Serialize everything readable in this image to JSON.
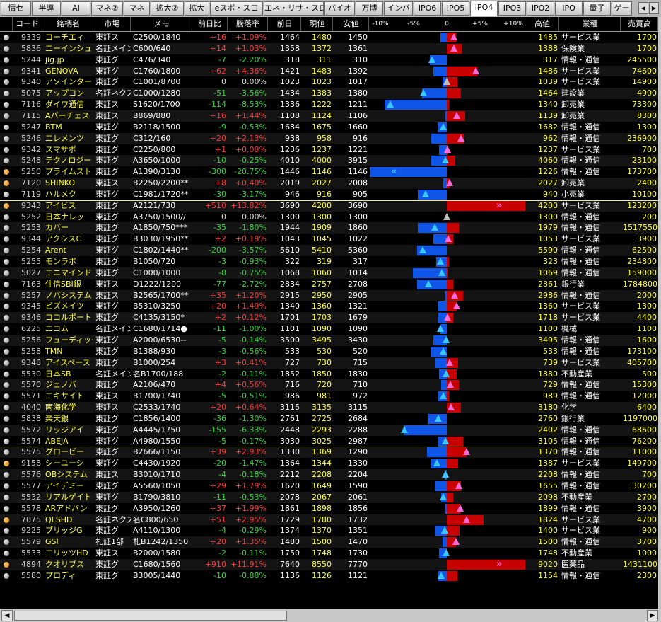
{
  "tabs": [
    "情セ",
    "半導",
    "AI",
    "マネ②",
    "マネ",
    "拡大②",
    "拡大",
    "eスポ・スロ",
    "エネ・リサ・スロ",
    "バイオ",
    "万博",
    "インバ",
    "IPO6",
    "IPO5",
    "IPO4",
    "IPO3",
    "IPO2",
    "IPO",
    "量子",
    "ゲー"
  ],
  "active_tab": "IPO4",
  "tab_nav": [
    "◀",
    "▶"
  ],
  "columns": {
    "code": "コード",
    "name": "銘柄名",
    "market": "市場",
    "memo": "メモ",
    "change": "前日比",
    "pct": "騰落率",
    "prev": "前日",
    "price": "現値",
    "low": "安値",
    "scale": [
      "-10%",
      "-5%",
      "0",
      "+5%",
      "+10%"
    ],
    "high": "高値",
    "sector": "業種",
    "value": "売買高"
  },
  "colors": {
    "up": "#ff3b3b",
    "down": "#38d838",
    "bar_up": "#c80000",
    "bar_down": "#0f55e8",
    "text": "#ffffff",
    "name": "#ffff40"
  },
  "rows": [
    {
      "mark": "grey",
      "code": "9339",
      "name": "コーチエィ",
      "market": "東証ス",
      "memo": "C2500/1840",
      "change": "+16",
      "pct": "+1.09%",
      "prev": "1464",
      "price": "1480",
      "low": "1450",
      "high": "1485",
      "sector": "サービス業",
      "value": "1700"
    },
    {
      "mark": "grey",
      "code": "5836",
      "name": "エーインシュ",
      "market": "名証メイン",
      "memo": "C600/640",
      "change": "+14",
      "pct": "+1.03%",
      "prev": "1358",
      "price": "1372",
      "low": "1361",
      "high": "1388",
      "sector": "保険業",
      "value": "1700"
    },
    {
      "mark": "grey",
      "code": "5244",
      "name": "jig.jp",
      "market": "東証グ",
      "memo": "C476/340",
      "change": "-7",
      "pct": "-2.20%",
      "prev": "318",
      "price": "311",
      "low": "310",
      "high": "317",
      "sector": "情報・通信",
      "value": "245500"
    },
    {
      "mark": "grey",
      "code": "9341",
      "name": "GENOVA",
      "market": "東証グ",
      "memo": "C1760/1800",
      "change": "+62",
      "pct": "+4.36%",
      "prev": "1421",
      "price": "1483",
      "low": "1392",
      "high": "1486",
      "sector": "サービス業",
      "value": "74600"
    },
    {
      "mark": "grey",
      "code": "9340",
      "name": "アソインター",
      "market": "東証グ",
      "memo": "C1001/8700",
      "change": "0",
      "pct": "0.00%",
      "prev": "1023",
      "price": "1023",
      "low": "1017",
      "high": "1039",
      "sector": "サービス業",
      "value": "14900"
    },
    {
      "mark": "grey",
      "code": "5075",
      "name": "アップコン",
      "market": "名証ネクス",
      "memo": "C1000/1280",
      "change": "-51",
      "pct": "-3.56%",
      "prev": "1434",
      "price": "1383",
      "low": "1380",
      "high": "1464",
      "sector": "建設業",
      "value": "4900"
    },
    {
      "mark": "grey",
      "code": "7116",
      "name": "ダイワ通信",
      "market": "東証ス",
      "memo": "S1620/1700",
      "change": "-114",
      "pct": "-8.53%",
      "prev": "1336",
      "price": "1222",
      "low": "1211",
      "high": "1340",
      "sector": "卸売業",
      "value": "73300"
    },
    {
      "mark": "grey",
      "code": "7115",
      "name": "Aパーチェス",
      "market": "東証ス",
      "memo": "B869/880",
      "change": "+16",
      "pct": "+1.44%",
      "prev": "1108",
      "price": "1124",
      "low": "1106",
      "high": "1139",
      "sector": "卸売業",
      "value": "8300"
    },
    {
      "mark": "grey",
      "code": "5247",
      "name": "BTM",
      "market": "東証グ",
      "memo": "B2118/1500",
      "change": "-9",
      "pct": "-0.53%",
      "prev": "1684",
      "price": "1675",
      "low": "1660",
      "high": "1682",
      "sector": "情報・通信",
      "value": "1300"
    },
    {
      "mark": "grey",
      "code": "5246",
      "name": "エレメンツ",
      "market": "東証グ",
      "memo": "C312/160",
      "change": "+20",
      "pct": "+2.13%",
      "prev": "938",
      "price": "958",
      "low": "916",
      "high": "962",
      "sector": "情報・通信",
      "value": "236900"
    },
    {
      "mark": "grey",
      "code": "9342",
      "name": "スマサポ",
      "market": "東証グ",
      "memo": "C2250/800",
      "change": "+1",
      "pct": "+0.08%",
      "prev": "1236",
      "price": "1237",
      "low": "1221",
      "high": "1237",
      "sector": "サービス業",
      "value": "700"
    },
    {
      "mark": "grey",
      "code": "5248",
      "name": "テクノロジー",
      "market": "東証グ",
      "memo": "A3650/1000",
      "change": "-10",
      "pct": "-0.25%",
      "prev": "4010",
      "price": "4000",
      "low": "3915",
      "high": "4060",
      "sector": "情報・通信",
      "value": "23100"
    },
    {
      "mark": "orange",
      "code": "5250",
      "name": "プライムスト",
      "market": "東証グ",
      "memo": "A1390/3130",
      "change": "-300",
      "pct": "-20.75%",
      "prev": "1446",
      "price": "1146",
      "low": "1146",
      "high": "1226",
      "sector": "情報・通信",
      "value": "173700"
    },
    {
      "mark": "orange",
      "code": "7120",
      "name": "SHINKO",
      "market": "東証ス",
      "memo": "B2250/2200**",
      "change": "+8",
      "pct": "+0.40%",
      "prev": "2019",
      "price": "2027",
      "low": "2008",
      "high": "2027",
      "sector": "卸売業",
      "value": "2400"
    },
    {
      "mark": "grey",
      "code": "7119",
      "name": "ハルメク",
      "market": "東証グ",
      "memo": "C1981/1720**",
      "change": "-30",
      "pct": "-3.17%",
      "prev": "946",
      "price": "916",
      "low": "905",
      "high": "940",
      "sector": "小売業",
      "value": "10100"
    },
    {
      "mark": "orange",
      "code": "9343",
      "name": "アイビス",
      "market": "東証グ",
      "memo": "A2121/730",
      "change": "+510",
      "pct": "+13.82%",
      "prev": "3690",
      "price": "4200",
      "low": "3690",
      "high": "4200",
      "sector": "サービス業",
      "value": "123200"
    },
    {
      "mark": "grey",
      "code": "5252",
      "name": "日本ナレッ",
      "market": "東証グ",
      "memo": "A3750/1500//",
      "change": "0",
      "pct": "0.00%",
      "prev": "1300",
      "price": "1300",
      "low": "1300",
      "high": "1300",
      "sector": "情報・通信",
      "value": "200"
    },
    {
      "mark": "grey",
      "code": "5253",
      "name": "カバー",
      "market": "東証グ",
      "memo": "A1850/750***",
      "change": "-35",
      "pct": "-1.80%",
      "prev": "1944",
      "price": "1909",
      "low": "1860",
      "high": "1979",
      "sector": "情報・通信",
      "value": "15175500"
    },
    {
      "mark": "grey",
      "code": "9344",
      "name": "アクシスC",
      "market": "東証グ",
      "memo": "B3030/1950**",
      "change": "+2",
      "pct": "+0.19%",
      "prev": "1043",
      "price": "1045",
      "low": "1022",
      "high": "1053",
      "sector": "サービス業",
      "value": "3900"
    },
    {
      "mark": "grey",
      "code": "5254",
      "name": "Arent",
      "market": "東証グ",
      "memo": "C1802/1440**",
      "change": "-200",
      "pct": "-3.57%",
      "prev": "5610",
      "price": "5410",
      "low": "5360",
      "high": "5590",
      "sector": "情報・通信",
      "value": "62500"
    },
    {
      "mark": "grey",
      "code": "5255",
      "name": "モンラボ",
      "market": "東証グ",
      "memo": "B1050/720",
      "change": "-3",
      "pct": "-0.93%",
      "prev": "322",
      "price": "319",
      "low": "317",
      "high": "323",
      "sector": "情報・通信",
      "value": "234800"
    },
    {
      "mark": "grey",
      "code": "5027",
      "name": "エニマインド",
      "market": "東証グ",
      "memo": "C1000/1000",
      "change": "-8",
      "pct": "-0.75%",
      "prev": "1068",
      "price": "1060",
      "low": "1014",
      "high": "1069",
      "sector": "情報・通信",
      "value": "159000"
    },
    {
      "mark": "grey",
      "code": "7163",
      "name": "住信SBI銀",
      "market": "東証ス",
      "memo": "D1222/1200",
      "change": "-77",
      "pct": "-2.72%",
      "prev": "2834",
      "price": "2757",
      "low": "2708",
      "high": "2861",
      "sector": "銀行業",
      "value": "1784800"
    },
    {
      "mark": "grey",
      "code": "5257",
      "name": "ノバシステム",
      "market": "東証ス",
      "memo": "B2565/1700**",
      "change": "+35",
      "pct": "+1.20%",
      "prev": "2915",
      "price": "2950",
      "low": "2905",
      "high": "2986",
      "sector": "情報・通信",
      "value": "2000"
    },
    {
      "mark": "grey",
      "code": "9345",
      "name": "ビズメイツ",
      "market": "東証グ",
      "memo": "B5310/3250",
      "change": "+20",
      "pct": "+1.49%",
      "prev": "1340",
      "price": "1360",
      "low": "1321",
      "high": "1360",
      "sector": "サービス業",
      "value": "1300"
    },
    {
      "mark": "grey",
      "code": "9346",
      "name": "ココルポート",
      "market": "東証グ",
      "memo": "C4135/3150*",
      "change": "+2",
      "pct": "+0.12%",
      "prev": "1701",
      "price": "1703",
      "low": "1679",
      "high": "1718",
      "sector": "サービス業",
      "value": "4400"
    },
    {
      "mark": "grey",
      "code": "6225",
      "name": "エコム",
      "market": "名証メイン",
      "memo": "C1680/1714●",
      "change": "-11",
      "pct": "-1.00%",
      "prev": "1101",
      "price": "1090",
      "low": "1090",
      "high": "1100",
      "sector": "機械",
      "value": "1100"
    },
    {
      "mark": "grey",
      "code": "5256",
      "name": "フューディック",
      "market": "東証グ",
      "memo": "A2000/6530--",
      "change": "-5",
      "pct": "-0.14%",
      "prev": "3500",
      "price": "3495",
      "low": "3430",
      "high": "3495",
      "sector": "情報・通信",
      "value": "1600"
    },
    {
      "mark": "grey",
      "code": "5258",
      "name": "TMN",
      "market": "東証グ",
      "memo": "B1388/930",
      "change": "-3",
      "pct": "-0.56%",
      "prev": "533",
      "price": "530",
      "low": "520",
      "high": "533",
      "sector": "情報・通信",
      "value": "173100"
    },
    {
      "mark": "grey",
      "code": "9348",
      "name": "アイスペース",
      "market": "東証グ",
      "memo": "B1000/254",
      "change": "+3",
      "pct": "+0.41%",
      "prev": "727",
      "price": "730",
      "low": "715",
      "high": "739",
      "sector": "サービス業",
      "value": "405700"
    },
    {
      "mark": "grey",
      "code": "5530",
      "name": "日本SB",
      "market": "名証メイン",
      "memo": "名B1700/188",
      "change": "-2",
      "pct": "-0.11%",
      "prev": "1852",
      "price": "1850",
      "low": "1830",
      "high": "1880",
      "sector": "不動産業",
      "value": "500"
    },
    {
      "mark": "grey",
      "code": "5570",
      "name": "ジェノバ",
      "market": "東証グ",
      "memo": "A2106/470",
      "change": "+4",
      "pct": "+0.56%",
      "prev": "716",
      "price": "720",
      "low": "710",
      "high": "729",
      "sector": "情報・通信",
      "value": "15300"
    },
    {
      "mark": "grey",
      "code": "5571",
      "name": "エキサイト",
      "market": "東証ス",
      "memo": "B1700/1740",
      "change": "-5",
      "pct": "-0.51%",
      "prev": "986",
      "price": "981",
      "low": "972",
      "high": "989",
      "sector": "情報・通信",
      "value": "12000"
    },
    {
      "mark": "grey",
      "code": "4040",
      "name": "南海化学",
      "market": "東証ス",
      "memo": "C2533/1740",
      "change": "+20",
      "pct": "+0.64%",
      "prev": "3115",
      "price": "3135",
      "low": "3115",
      "high": "3180",
      "sector": "化学",
      "value": "6400"
    },
    {
      "mark": "grey",
      "code": "5838",
      "name": "楽天銀",
      "market": "東証グ",
      "memo": "C1856/1400",
      "change": "-36",
      "pct": "-1.30%",
      "prev": "2761",
      "price": "2725",
      "low": "2684",
      "high": "2760",
      "sector": "銀行業",
      "value": "1197000"
    },
    {
      "mark": "grey",
      "code": "5572",
      "name": "リッジアイ",
      "market": "東証グ",
      "memo": "A4445/1750",
      "change": "-155",
      "pct": "-6.33%",
      "prev": "2448",
      "price": "2293",
      "low": "2288",
      "high": "2402",
      "sector": "情報・通信",
      "value": "68600"
    },
    {
      "mark": "grey",
      "code": "5574",
      "name": "ABEJA",
      "market": "東証グ",
      "memo": "A4980/1550",
      "change": "-5",
      "pct": "-0.17%",
      "prev": "3030",
      "price": "3025",
      "low": "2987",
      "high": "3105",
      "sector": "情報・通信",
      "value": "76200"
    },
    {
      "mark": "grey",
      "code": "5575",
      "name": "グロービー",
      "market": "東証グ",
      "memo": "B2666/1150",
      "change": "+39",
      "pct": "+2.93%",
      "prev": "1330",
      "price": "1369",
      "low": "1290",
      "high": "1370",
      "sector": "情報・通信",
      "value": "11000"
    },
    {
      "mark": "orange",
      "code": "9158",
      "name": "シーユーシ",
      "market": "東証グ",
      "memo": "C4430/1920",
      "change": "-20",
      "pct": "-1.47%",
      "prev": "1364",
      "price": "1344",
      "low": "1330",
      "high": "1387",
      "sector": "サービス業",
      "value": "149700"
    },
    {
      "mark": "grey",
      "code": "5576",
      "name": "OBシステム",
      "market": "東証ス",
      "memo": "B3010/1710",
      "change": "-4",
      "pct": "-0.18%",
      "prev": "2212",
      "price": "2208",
      "low": "2204",
      "high": "2208",
      "sector": "情報・通信",
      "value": "700"
    },
    {
      "mark": "grey",
      "code": "5577",
      "name": "アイデミー",
      "market": "東証グ",
      "memo": "A5560/1050",
      "change": "+29",
      "pct": "+1.79%",
      "prev": "1620",
      "price": "1649",
      "low": "1590",
      "high": "1655",
      "sector": "情報・通信",
      "value": "30200"
    },
    {
      "mark": "grey",
      "code": "5532",
      "name": "リアルゲイト",
      "market": "東証グ",
      "memo": "B1790/3810",
      "change": "-11",
      "pct": "-0.53%",
      "prev": "2078",
      "price": "2067",
      "low": "2061",
      "high": "2098",
      "sector": "不動産業",
      "value": "2700"
    },
    {
      "mark": "grey",
      "code": "5578",
      "name": "ARアドバン",
      "market": "東証グ",
      "memo": "A3950/1260",
      "change": "+37",
      "pct": "+1.99%",
      "prev": "1861",
      "price": "1898",
      "low": "1856",
      "high": "1899",
      "sector": "情報・通信",
      "value": "3900"
    },
    {
      "mark": "orange",
      "code": "7075",
      "name": "QLSHD",
      "market": "名証ネクス",
      "memo": "名C800/650",
      "change": "+51",
      "pct": "+2.95%",
      "prev": "1729",
      "price": "1780",
      "low": "1732",
      "high": "1824",
      "sector": "サービス業",
      "value": "4700"
    },
    {
      "mark": "grey",
      "code": "9225",
      "name": "ブリッジG",
      "market": "東証グ",
      "memo": "A4110/1300",
      "change": "-4",
      "pct": "-0.29%",
      "prev": "1374",
      "price": "1370",
      "low": "1351",
      "high": "1400",
      "sector": "サービス業",
      "value": "900"
    },
    {
      "mark": "grey",
      "code": "5579",
      "name": "GSI",
      "market": "札証1部",
      "memo": "札B1242/1350",
      "change": "+20",
      "pct": "+1.35%",
      "prev": "1480",
      "price": "1500",
      "low": "1470",
      "high": "1500",
      "sector": "情報・通信",
      "value": "3700"
    },
    {
      "mark": "grey",
      "code": "5533",
      "name": "エリッツHD",
      "market": "東証ス",
      "memo": "B2000/1580",
      "change": "-2",
      "pct": "-0.11%",
      "prev": "1750",
      "price": "1748",
      "low": "1730",
      "high": "1748",
      "sector": "不動産業",
      "value": "1000"
    },
    {
      "mark": "orange",
      "code": "4894",
      "name": "クオリプス",
      "market": "東証グ",
      "memo": "C1680/1560",
      "change": "+910",
      "pct": "+11.91%",
      "prev": "7640",
      "price": "8550",
      "low": "7770",
      "high": "9020",
      "sector": "医薬品",
      "value": "1431100"
    },
    {
      "mark": "grey",
      "code": "5580",
      "name": "プロディ",
      "market": "東証グ",
      "memo": "B3005/1440",
      "change": "-10",
      "pct": "-0.88%",
      "prev": "1136",
      "price": "1126",
      "low": "1121",
      "high": "1154",
      "sector": "情報・通信",
      "value": "2300"
    }
  ],
  "scroll": {
    "left": "◀",
    "right": "▶"
  }
}
